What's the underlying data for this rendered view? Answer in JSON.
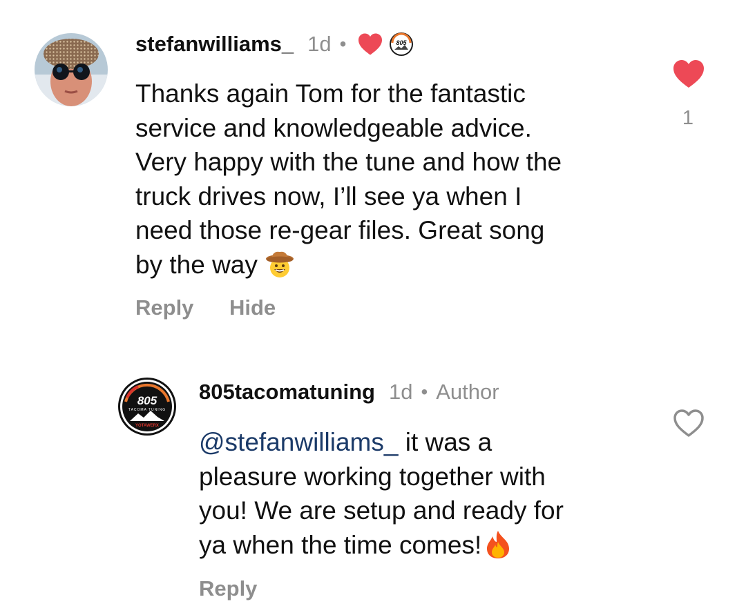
{
  "comments": [
    {
      "username": "stefanwilliams_",
      "time": "1d",
      "separator": "•",
      "badge_text": "805",
      "body_lines": [
        "Thanks again Tom for the fantastic",
        "service and knowledgeable advice.",
        "Very happy with the tune and how the",
        "truck drives now, I’ll see ya when I",
        "need those re-gear files.  Great song",
        "by the way"
      ],
      "emoji": "cowboy-face",
      "like_count": "1",
      "liked": true,
      "reply_label": "Reply",
      "hide_label": "Hide"
    },
    {
      "username": "805tacomatuning",
      "time": "1d",
      "separator": "•",
      "author_label": "Author",
      "mention": "@stefanwilliams_",
      "body_first_rest": " it was a",
      "body_lines": [
        "pleasure working together with",
        "you! We are setup and ready for",
        "ya when the time comes!"
      ],
      "emoji": "fire",
      "liked": false,
      "reply_label": "Reply",
      "logo_number": "805",
      "logo_subtitle": "TACOMA TUNING",
      "logo_brand": "YOTAWERX"
    }
  ],
  "colors": {
    "heart_red": "#ed4956",
    "muted": "#8e8e8e",
    "mention": "#1b3a68"
  }
}
